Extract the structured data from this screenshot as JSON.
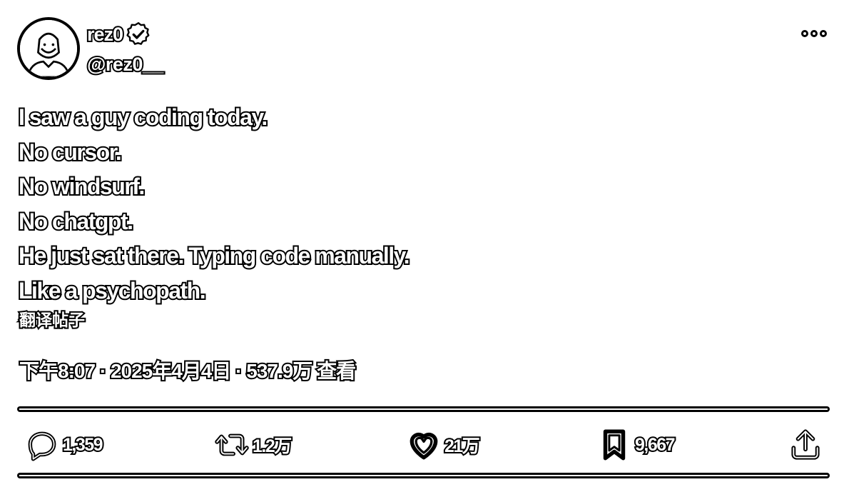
{
  "author": {
    "display_name": "rez0",
    "handle": "@rez0__",
    "verified_icon": "verified-badge-icon",
    "avatar_icon": "avatar-portrait"
  },
  "tweet": {
    "lines": [
      "I saw a guy coding today.",
      "No cursor.",
      "No windsurf.",
      "No chatgpt.",
      "He just sat there. Typing code manually.",
      "Like a psychopath."
    ],
    "translate_label": "翻译帖子"
  },
  "meta": {
    "time": "下午8:07",
    "separator": "·",
    "date": "2025年4月4日",
    "views_count": "537.9万",
    "views_label": "查看"
  },
  "actions": {
    "replies": {
      "count": "1,359",
      "icon": "reply-icon"
    },
    "reposts": {
      "count": "1.2万",
      "icon": "repost-icon"
    },
    "likes": {
      "count": "21万",
      "icon": "heart-icon"
    },
    "bookmarks": {
      "count": "9,667",
      "icon": "bookmark-icon"
    },
    "share": {
      "icon": "share-icon"
    }
  }
}
